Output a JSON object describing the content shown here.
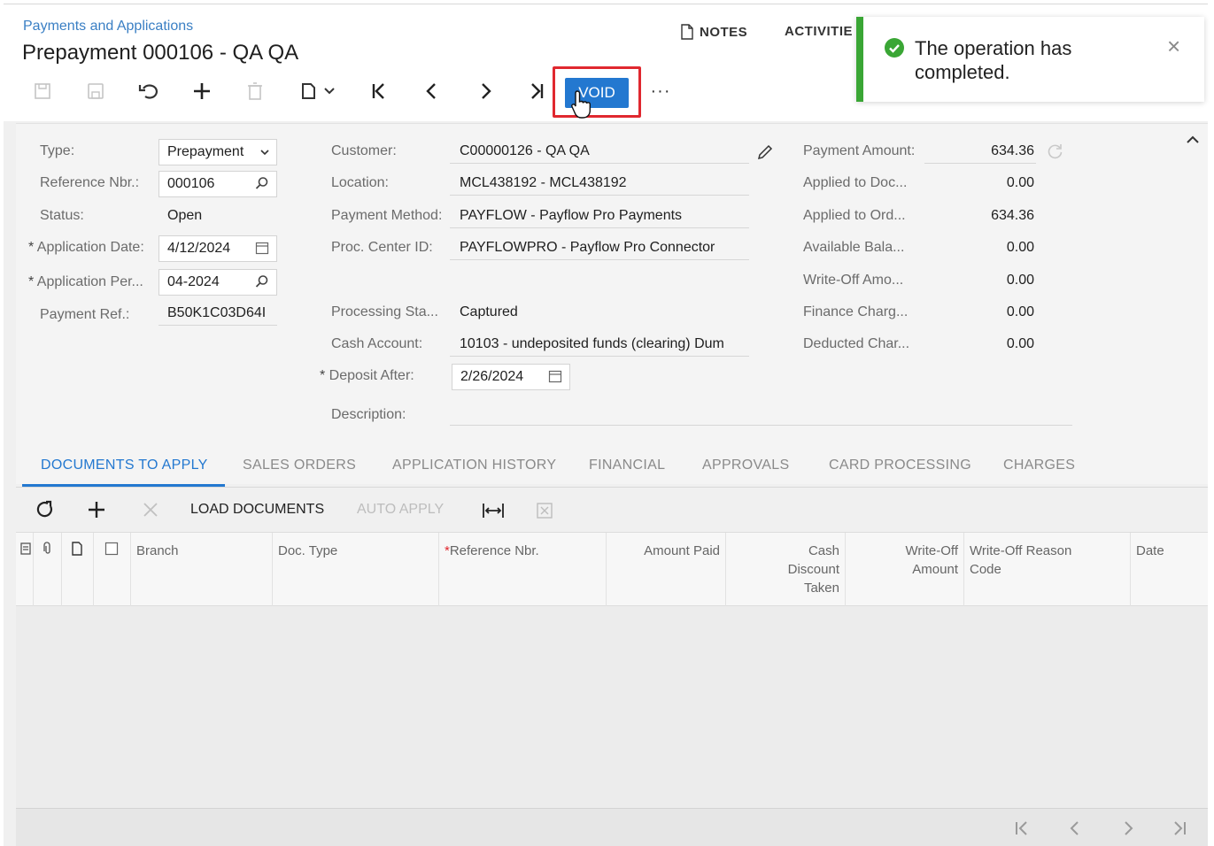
{
  "header": {
    "breadcrumb": "Payments and Applications",
    "title": "Prepayment 000106 - QA QA",
    "notes_label": "NOTES",
    "activities_label": "ACTIVITIE"
  },
  "toolbar": {
    "void_label": "VOID",
    "more_label": "···"
  },
  "toast": {
    "message": "The operation has completed.",
    "close_label": "×",
    "status_color": "#3aa635"
  },
  "form": {
    "type": {
      "label": "Type:",
      "value": "Prepayment"
    },
    "reference_nbr": {
      "label": "Reference Nbr.:",
      "value": "000106"
    },
    "status": {
      "label": "Status:",
      "value": "Open"
    },
    "application_date": {
      "label": "Application Date:",
      "value": "4/12/2024"
    },
    "application_period": {
      "label": "Application Per...",
      "value": "04-2024"
    },
    "payment_ref": {
      "label": "Payment Ref.:",
      "value": "B50K1C03D64I"
    },
    "customer": {
      "label": "Customer:",
      "value": "C00000126 - QA QA"
    },
    "location": {
      "label": "Location:",
      "value": "MCL438192 - MCL438192"
    },
    "payment_method": {
      "label": "Payment Method:",
      "value": "PAYFLOW - Payflow Pro Payments"
    },
    "proc_center": {
      "label": "Proc. Center ID:",
      "value": "PAYFLOWPRO - Payflow Pro Connector"
    },
    "processing_status": {
      "label": "Processing Sta...",
      "value": "Captured"
    },
    "cash_account": {
      "label": "Cash Account:",
      "value": "10103 - undeposited funds (clearing) Dum"
    },
    "deposit_after": {
      "label": "Deposit After:",
      "value": "2/26/2024"
    },
    "description": {
      "label": "Description:",
      "value": ""
    },
    "payment_amount": {
      "label": "Payment Amount:",
      "value": "634.36"
    },
    "applied_to_doc": {
      "label": "Applied to Doc...",
      "value": "0.00"
    },
    "applied_to_ord": {
      "label": "Applied to Ord...",
      "value": "634.36"
    },
    "available_balance": {
      "label": "Available Bala...",
      "value": "0.00"
    },
    "write_off_amount": {
      "label": "Write-Off Amo...",
      "value": "0.00"
    },
    "finance_charges": {
      "label": "Finance Charg...",
      "value": "0.00"
    },
    "deducted_charges": {
      "label": "Deducted Char...",
      "value": "0.00"
    }
  },
  "tabs": [
    {
      "label": "DOCUMENTS TO APPLY"
    },
    {
      "label": "SALES ORDERS"
    },
    {
      "label": "APPLICATION HISTORY"
    },
    {
      "label": "FINANCIAL"
    },
    {
      "label": "APPROVALS"
    },
    {
      "label": "CARD PROCESSING"
    },
    {
      "label": "CHARGES"
    }
  ],
  "grid_toolbar": {
    "load_documents": "LOAD DOCUMENTS",
    "auto_apply": "AUTO APPLY"
  },
  "grid_columns": {
    "branch": "Branch",
    "doc_type": "Doc. Type",
    "reference_nbr": "Reference Nbr.",
    "amount_paid": "Amount Paid",
    "cash_discount_1": "Cash",
    "cash_discount_2": "Discount",
    "cash_discount_3": "Taken",
    "write_off_amount_1": "Write-Off",
    "write_off_amount_2": "Amount",
    "write_off_reason_1": "Write-Off Reason",
    "write_off_reason_2": "Code",
    "date": "Date"
  },
  "colors": {
    "accent": "#2378d0",
    "highlight_border": "#e0282f"
  }
}
